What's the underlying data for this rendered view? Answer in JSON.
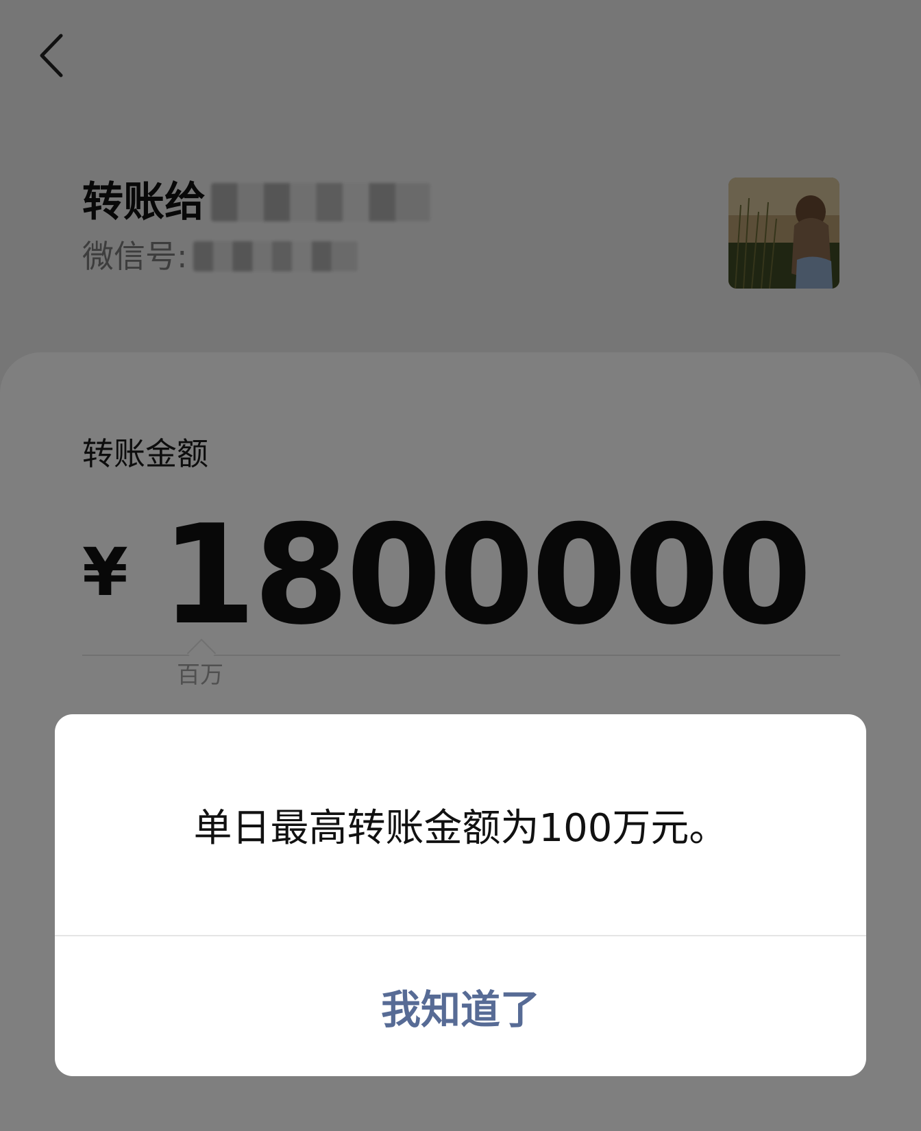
{
  "header": {
    "back_icon": "chevron-left-icon"
  },
  "payee": {
    "title_prefix": "转账给",
    "wechat_id_label": "微信号: ",
    "avatar_icon": "avatar-photo"
  },
  "transfer": {
    "amount_label": "转账金额",
    "currency_symbol": "¥",
    "amount_value": "1800000",
    "unit_hint": "百万"
  },
  "dialog": {
    "message": "单日最高转账金额为100万元。",
    "confirm_label": "我知道了"
  },
  "colors": {
    "background": "#ededed",
    "card": "#ffffff",
    "accent": "#576b95",
    "mask": "rgba(0,0,0,0.5)"
  }
}
